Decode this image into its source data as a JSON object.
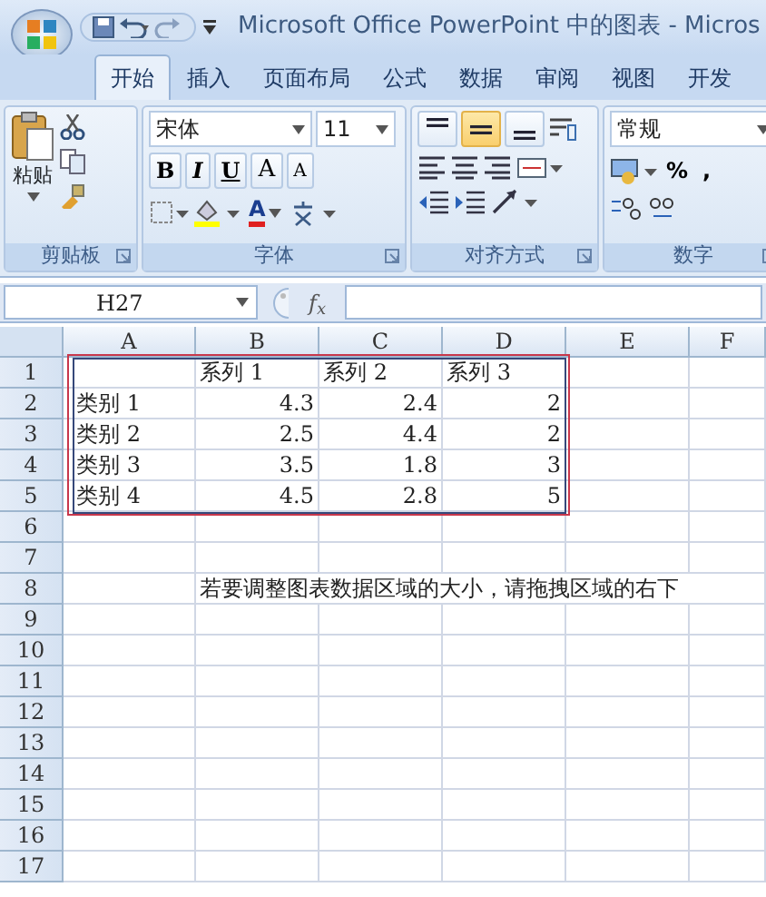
{
  "title_bar": {
    "title": "Microsoft Office PowerPoint 中的图表 - Micros"
  },
  "tabs": [
    {
      "label": "开始",
      "selected": true
    },
    {
      "label": "插入",
      "selected": false
    },
    {
      "label": "页面布局",
      "selected": false
    },
    {
      "label": "公式",
      "selected": false
    },
    {
      "label": "数据",
      "selected": false
    },
    {
      "label": "审阅",
      "selected": false
    },
    {
      "label": "视图",
      "selected": false
    },
    {
      "label": "开发",
      "selected": false
    }
  ],
  "ribbon": {
    "clipboard": {
      "label": "剪贴板",
      "paste_label": "粘贴"
    },
    "font": {
      "label": "字体",
      "font_name": "宋体",
      "font_size": "11",
      "style_buttons": [
        "B",
        "I",
        "U"
      ],
      "size_buttons": [
        "A",
        "A"
      ],
      "font_color_button": "A"
    },
    "alignment": {
      "label": "对齐方式",
      "vertical_buttons": [
        {
          "selected": false
        },
        {
          "selected": true
        },
        {
          "selected": false
        }
      ]
    },
    "number": {
      "label": "数字",
      "format": "常规",
      "buttons": [
        "%",
        ","
      ]
    }
  },
  "formula_bar": {
    "name_box": "H27",
    "function_label": "f$_{x}$"
  },
  "sheet": {
    "columns": [
      "A",
      "B",
      "C",
      "D",
      "E",
      "F"
    ],
    "rows": [
      {
        "header": "1",
        "kind": "text",
        "cells": [
          "",
          "系列 1",
          "系列 2",
          "系列 3",
          "",
          ""
        ]
      },
      {
        "header": "2",
        "kind": "data",
        "cells": [
          "类别 1",
          "4.3",
          "2.4",
          "2",
          "",
          ""
        ]
      },
      {
        "header": "3",
        "kind": "data",
        "cells": [
          "类别 2",
          "2.5",
          "4.4",
          "2",
          "",
          ""
        ]
      },
      {
        "header": "4",
        "kind": "data",
        "cells": [
          "类别 3",
          "3.5",
          "1.8",
          "3",
          "",
          ""
        ]
      },
      {
        "header": "5",
        "kind": "data",
        "cells": [
          "类别 4",
          "4.5",
          "2.8",
          "5",
          "",
          ""
        ]
      },
      {
        "header": "6",
        "cells": [
          "",
          "",
          "",
          "",
          "",
          ""
        ]
      },
      {
        "header": "7",
        "cells": [
          "",
          "",
          "",
          "",
          "",
          ""
        ]
      },
      {
        "header": "8",
        "kind": "note",
        "cells": [
          "",
          "若要调整图表数据区域的大小，请拖拽区域的右下",
          "",
          "",
          "",
          ""
        ]
      },
      {
        "header": "9",
        "cells": [
          "",
          "",
          "",
          "",
          "",
          ""
        ]
      },
      {
        "header": "10",
        "cells": [
          "",
          "",
          "",
          "",
          "",
          ""
        ]
      },
      {
        "header": "11",
        "cells": [
          "",
          "",
          "",
          "",
          "",
          ""
        ]
      },
      {
        "header": "12",
        "cells": [
          "",
          "",
          "",
          "",
          "",
          ""
        ]
      },
      {
        "header": "13",
        "cells": [
          "",
          "",
          "",
          "",
          "",
          ""
        ]
      },
      {
        "header": "14",
        "cells": [
          "",
          "",
          "",
          "",
          "",
          ""
        ]
      },
      {
        "header": "15",
        "cells": [
          "",
          "",
          "",
          "",
          "",
          ""
        ]
      },
      {
        "header": "16",
        "cells": [
          "",
          "",
          "",
          "",
          "",
          ""
        ]
      },
      {
        "header": "17",
        "cells": [
          "",
          "",
          "",
          "",
          "",
          ""
        ]
      }
    ]
  }
}
